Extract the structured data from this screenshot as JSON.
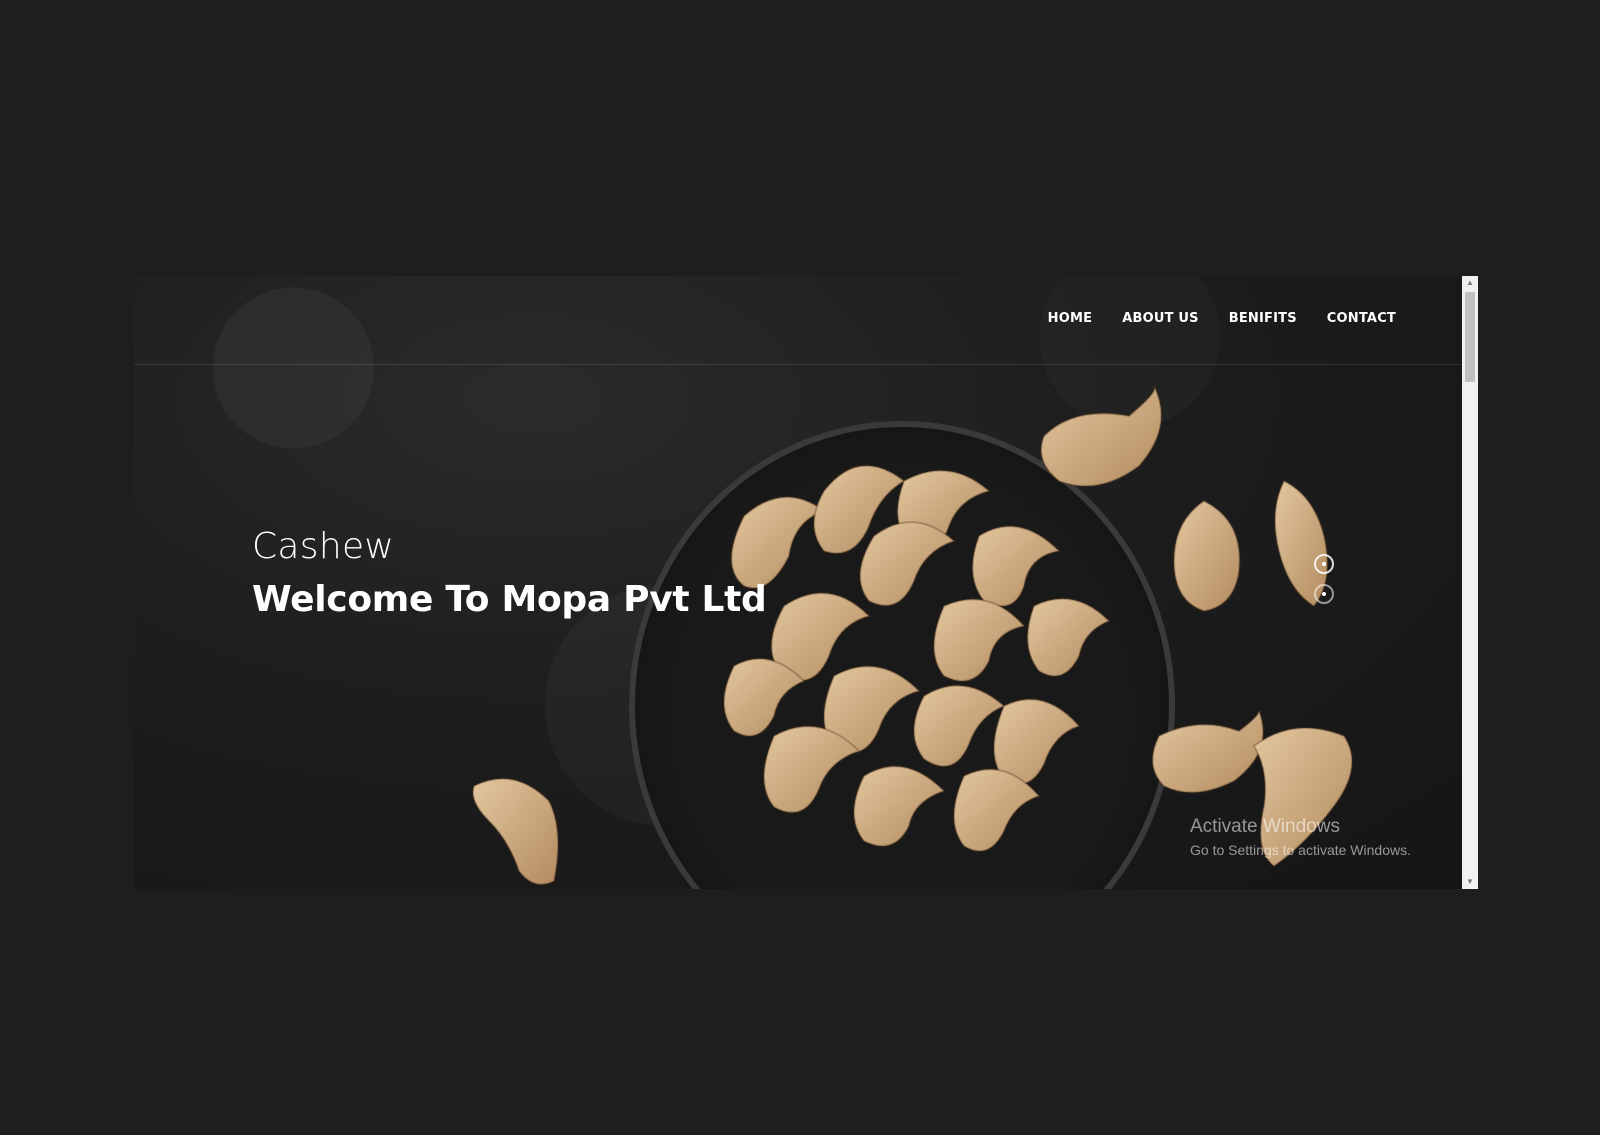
{
  "nav": {
    "items": [
      {
        "label": "HOME"
      },
      {
        "label": "ABOUT US"
      },
      {
        "label": "BENIFITS"
      },
      {
        "label": "CONTACT"
      }
    ]
  },
  "hero": {
    "subtitle": "Cashew",
    "title": "Welcome To Mopa Pvt Ltd"
  },
  "slider": {
    "dots": 2,
    "active": 0
  },
  "watermark": {
    "line1": "Activate Windows",
    "line2": "Go to Settings to activate Windows."
  },
  "colors": {
    "page_background": "#1d1e20",
    "hero_text": "#ffffff",
    "cashew": "#c8a87d",
    "bowl": "#2a2a2a"
  }
}
